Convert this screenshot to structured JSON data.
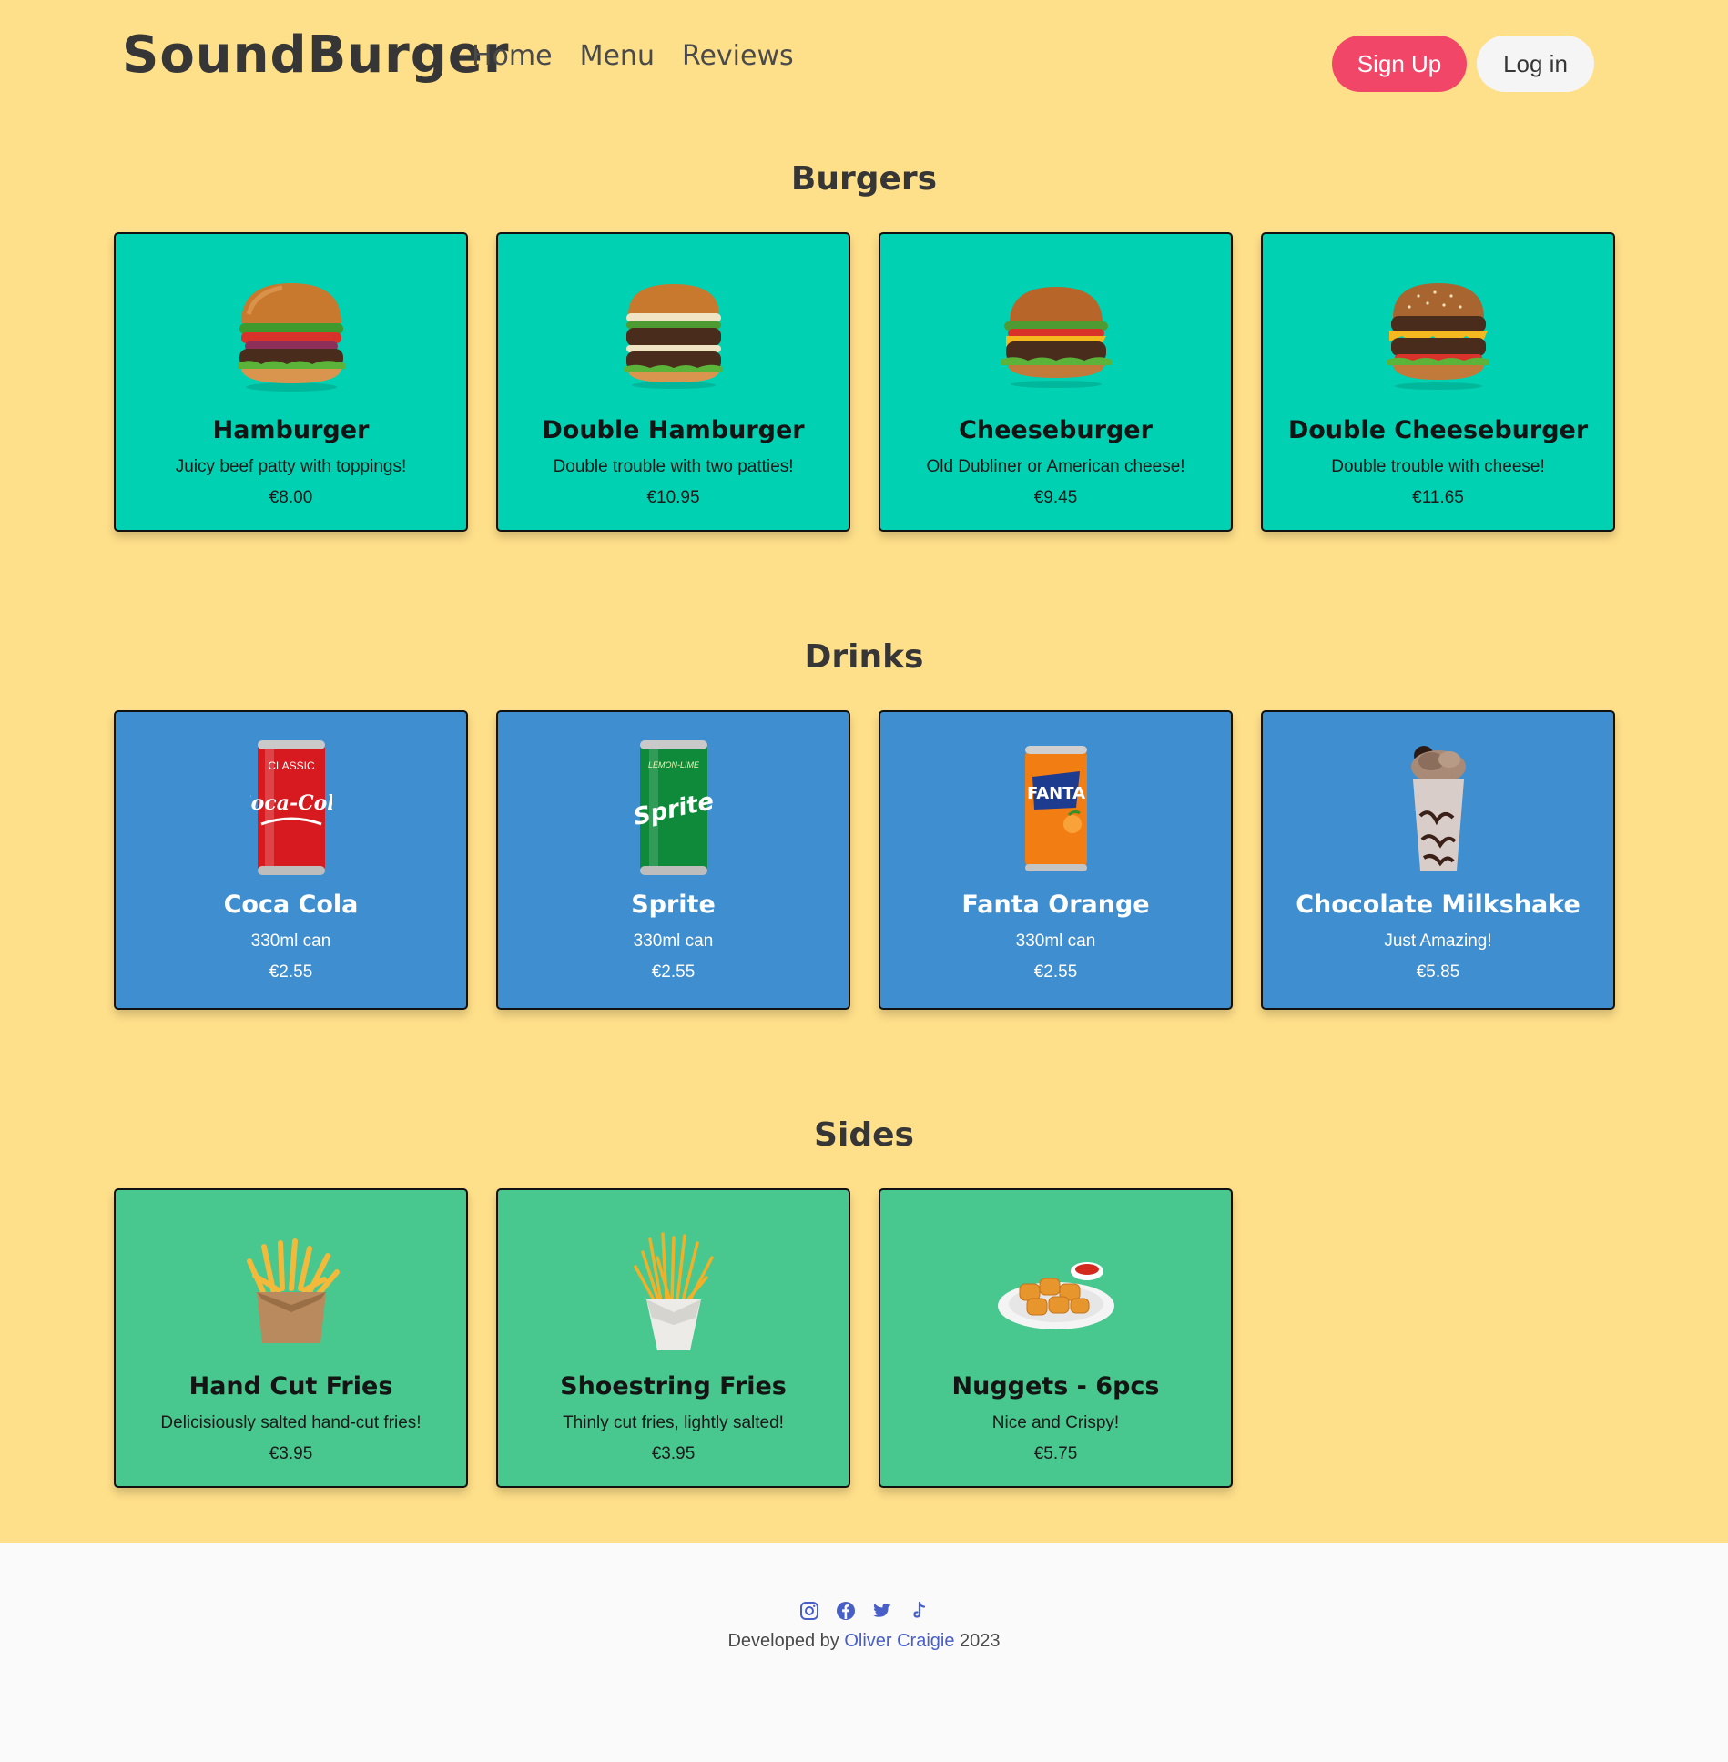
{
  "brand": "SoundBurger",
  "nav": {
    "links": [
      "Home",
      "Menu",
      "Reviews"
    ],
    "signup": "Sign Up",
    "login": "Log in"
  },
  "sections": [
    {
      "title": "Burgers",
      "items": [
        {
          "name": "Hamburger",
          "desc": "Juicy beef patty with toppings!",
          "price": "€8.00",
          "icon": "burger-icon"
        },
        {
          "name": "Double Hamburger",
          "desc": "Double trouble with two patties!",
          "price": "€10.95",
          "icon": "double-burger-icon"
        },
        {
          "name": "Cheeseburger",
          "desc": "Old Dubliner or American cheese!",
          "price": "€9.45",
          "icon": "cheeseburger-icon"
        },
        {
          "name": "Double Cheeseburger",
          "desc": "Double trouble with cheese!",
          "price": "€11.65",
          "icon": "double-cheeseburger-icon"
        }
      ]
    },
    {
      "title": "Drinks",
      "items": [
        {
          "name": "Coca Cola",
          "desc": "330ml can",
          "price": "€2.55",
          "icon": "coca-cola-can-icon",
          "can_text": "CLASSIC",
          "logo_text": "Coca-Cola"
        },
        {
          "name": "Sprite",
          "desc": "330ml can",
          "price": "€2.55",
          "icon": "sprite-can-icon",
          "can_text": "LEMON-LIME",
          "logo_text": "Sprite"
        },
        {
          "name": "Fanta Orange",
          "desc": "330ml can",
          "price": "€2.55",
          "icon": "fanta-can-icon",
          "logo_text": "FANTA"
        },
        {
          "name": "Chocolate Milkshake",
          "desc": "Just Amazing!",
          "price": "€5.85",
          "icon": "milkshake-icon"
        }
      ]
    },
    {
      "title": "Sides",
      "items": [
        {
          "name": "Hand Cut Fries",
          "desc": "Delicisiously salted hand-cut fries!",
          "price": "€3.95",
          "icon": "fries-bag-icon"
        },
        {
          "name": "Shoestring Fries",
          "desc": "Thinly cut fries, lightly salted!",
          "price": "€3.95",
          "icon": "fries-cup-icon"
        },
        {
          "name": "Nuggets - 6pcs",
          "desc": "Nice and Crispy!",
          "price": "€5.75",
          "icon": "nuggets-icon"
        }
      ]
    }
  ],
  "footer": {
    "social": [
      "instagram-icon",
      "facebook-icon",
      "twitter-icon",
      "tiktok-icon"
    ],
    "prefix": "Developed by",
    "author": "Oliver Craigie",
    "year": "2023"
  },
  "colors": {
    "page_bg": "#ffe08a",
    "burgers_card": "#00d1b2",
    "drinks_card": "#3e8ed0",
    "sides_card": "#48c78e",
    "signup": "#f14668",
    "link": "#485fc7"
  }
}
